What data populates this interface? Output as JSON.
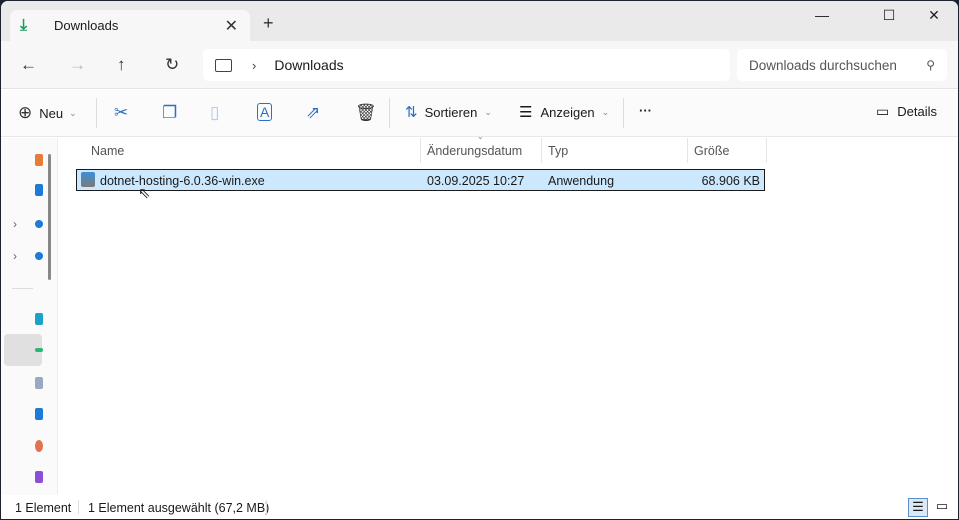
{
  "tab": {
    "title": "Downloads",
    "close": "✕",
    "new": "+"
  },
  "window": {
    "minimize": "—",
    "maximize": "☐",
    "close": "✕"
  },
  "address": {
    "location": "Downloads",
    "search_placeholder": "Downloads durchsuchen"
  },
  "toolbar": {
    "new": "Neu",
    "sort": "Sortieren",
    "view": "Anzeigen",
    "more": "···",
    "details": "Details"
  },
  "columns": [
    "Name",
    "Änderungsdatum",
    "Typ",
    "Größe"
  ],
  "files": [
    {
      "name": "dotnet-hosting-6.0.36-win.exe",
      "modified": "03.09.2025 10:27",
      "type": "Anwendung",
      "size": "68.906 KB"
    }
  ],
  "status": {
    "count": "1 Element",
    "selected": "1 Element ausgewählt (67,2 MB)"
  }
}
